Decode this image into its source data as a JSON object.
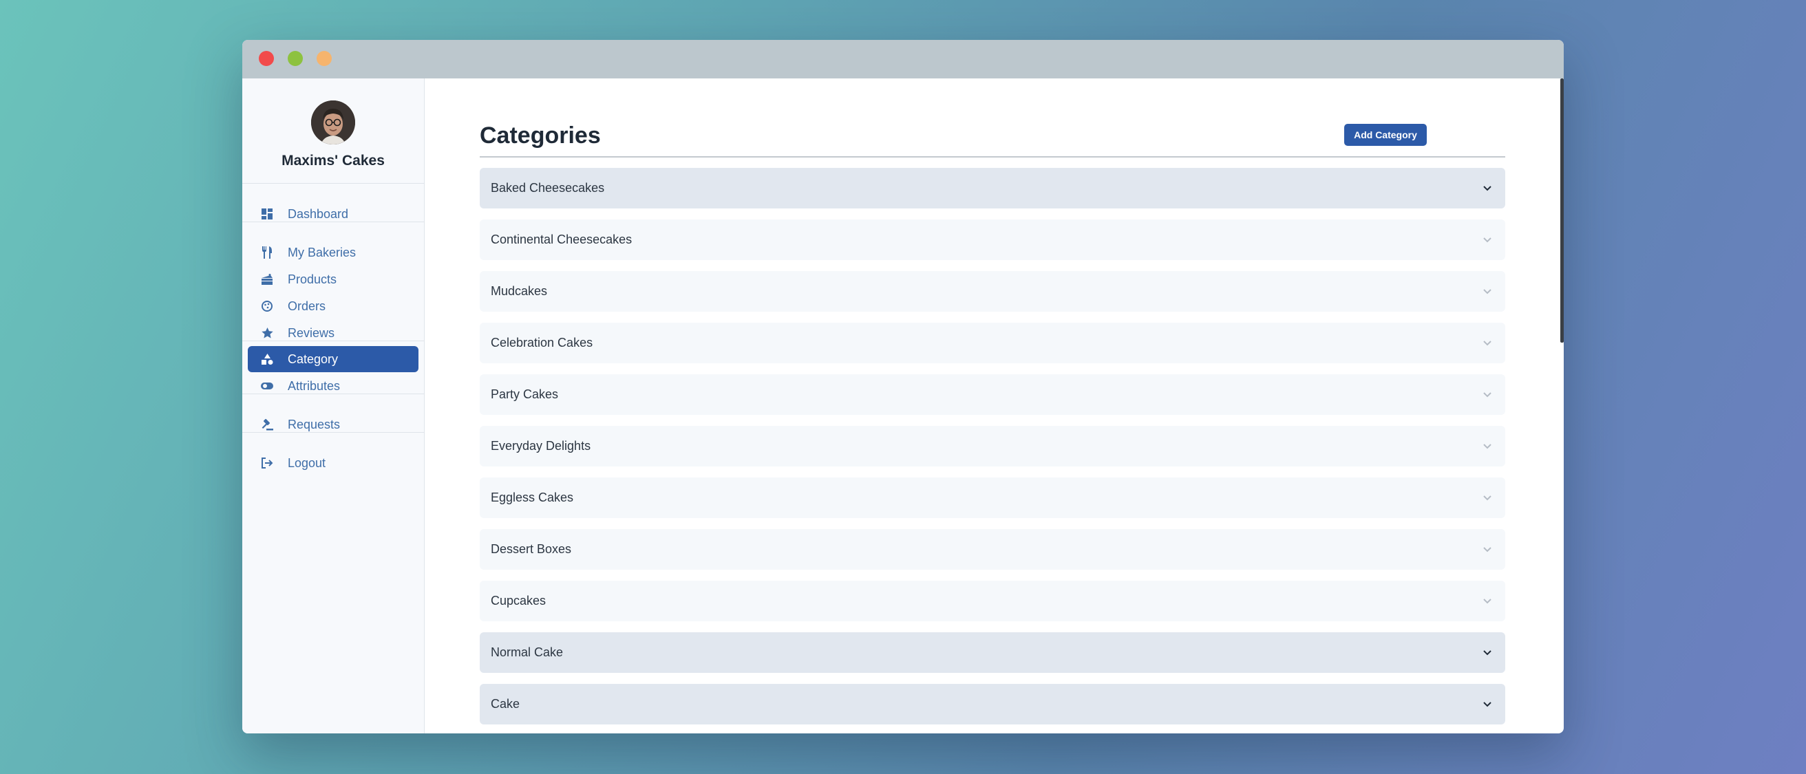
{
  "sidebar": {
    "brand": "Maxims' Cakes",
    "nav": {
      "dashboard": "Dashboard",
      "my_bakeries": "My Bakeries",
      "products": "Products",
      "orders": "Orders",
      "reviews": "Reviews",
      "category": "Category",
      "attributes": "Attributes",
      "requests": "Requests",
      "logout": "Logout"
    },
    "active_item": "Category"
  },
  "main": {
    "title": "Categories",
    "add_button_label": "Add Category",
    "categories": [
      {
        "label": "Baked Cheesecakes",
        "expanded": true
      },
      {
        "label": "Continental Cheesecakes",
        "expanded": false
      },
      {
        "label": "Mudcakes",
        "expanded": false
      },
      {
        "label": "Celebration Cakes",
        "expanded": false
      },
      {
        "label": "Party Cakes",
        "expanded": false
      },
      {
        "label": "Everyday Delights",
        "expanded": false
      },
      {
        "label": "Eggless Cakes",
        "expanded": false
      },
      {
        "label": "Dessert Boxes",
        "expanded": false
      },
      {
        "label": "Cupcakes",
        "expanded": false
      },
      {
        "label": "Normal Cake",
        "expanded": true
      },
      {
        "label": "Cake",
        "expanded": true
      }
    ]
  },
  "icons": {
    "dashboard": "dashboard-grid-icon",
    "my_bakeries": "fork-knife-icon",
    "products": "cake-slice-icon",
    "orders": "cookie-icon",
    "reviews": "star-icon",
    "category": "shapes-icon",
    "attributes": "toggle-icon",
    "requests": "gavel-icon",
    "logout": "logout-icon",
    "chevron": "chevron-down-icon"
  },
  "colors": {
    "accent": "#2c5aa8",
    "link": "#3f6ea8",
    "row_bg": "#f5f8fb",
    "row_expanded_bg": "#e1e7ef"
  }
}
